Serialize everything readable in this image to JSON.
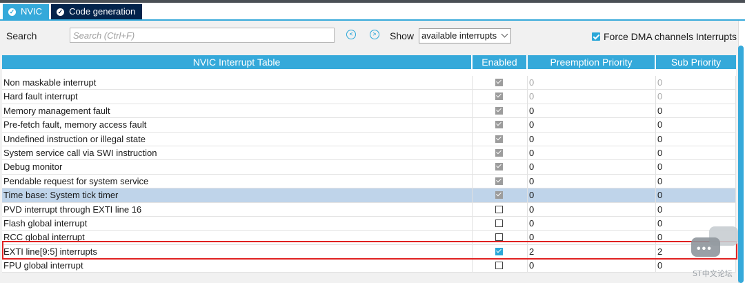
{
  "tabs": [
    {
      "label": "NVIC",
      "active": true
    },
    {
      "label": "Code generation",
      "active": false
    }
  ],
  "toolbar": {
    "search_label": "Search",
    "search_placeholder": "Search (Ctrl+F)",
    "show_label": "Show",
    "show_value": "available interrupts",
    "force_dma_label": "Force DMA channels Interrupts",
    "force_dma_checked": true
  },
  "table": {
    "headers": [
      "NVIC Interrupt Table",
      "Enabled",
      "Preemption Priority",
      "Sub Priority"
    ],
    "rows": [
      {
        "name": "Non maskable interrupt",
        "enabled": "locked",
        "preemption": "0",
        "sub": "0",
        "dim": true
      },
      {
        "name": "Hard fault interrupt",
        "enabled": "locked",
        "preemption": "0",
        "sub": "0",
        "dim": true
      },
      {
        "name": "Memory management fault",
        "enabled": "locked",
        "preemption": "0",
        "sub": "0",
        "dim": false
      },
      {
        "name": "Pre-fetch fault, memory access fault",
        "enabled": "locked",
        "preemption": "0",
        "sub": "0",
        "dim": false
      },
      {
        "name": "Undefined instruction or illegal state",
        "enabled": "locked",
        "preemption": "0",
        "sub": "0",
        "dim": false
      },
      {
        "name": "System service call via SWI instruction",
        "enabled": "locked",
        "preemption": "0",
        "sub": "0",
        "dim": false
      },
      {
        "name": "Debug monitor",
        "enabled": "locked",
        "preemption": "0",
        "sub": "0",
        "dim": false
      },
      {
        "name": "Pendable request for system service",
        "enabled": "locked",
        "preemption": "0",
        "sub": "0",
        "dim": false
      },
      {
        "name": "Time base: System tick timer",
        "enabled": "locked",
        "preemption": "0",
        "sub": "0",
        "dim": false,
        "selected": true
      },
      {
        "name": "PVD interrupt through EXTI line 16",
        "enabled": "off",
        "preemption": "0",
        "sub": "0",
        "dim": false
      },
      {
        "name": "Flash global interrupt",
        "enabled": "off",
        "preemption": "0",
        "sub": "0",
        "dim": false
      },
      {
        "name": "RCC global interrupt",
        "enabled": "off",
        "preemption": "0",
        "sub": "0",
        "dim": false
      },
      {
        "name": "EXTI line[9:5] interrupts",
        "enabled": "on",
        "preemption": "2",
        "sub": "2",
        "dim": false
      },
      {
        "name": "FPU global interrupt",
        "enabled": "off",
        "preemption": "0",
        "sub": "0",
        "dim": false
      }
    ]
  },
  "watermark": {
    "text": "ST中文论坛"
  },
  "colors": {
    "accent": "#35a9da",
    "dark_tab": "#03234b",
    "selected_row": "#bfd4ea",
    "highlight": "#e02020"
  }
}
